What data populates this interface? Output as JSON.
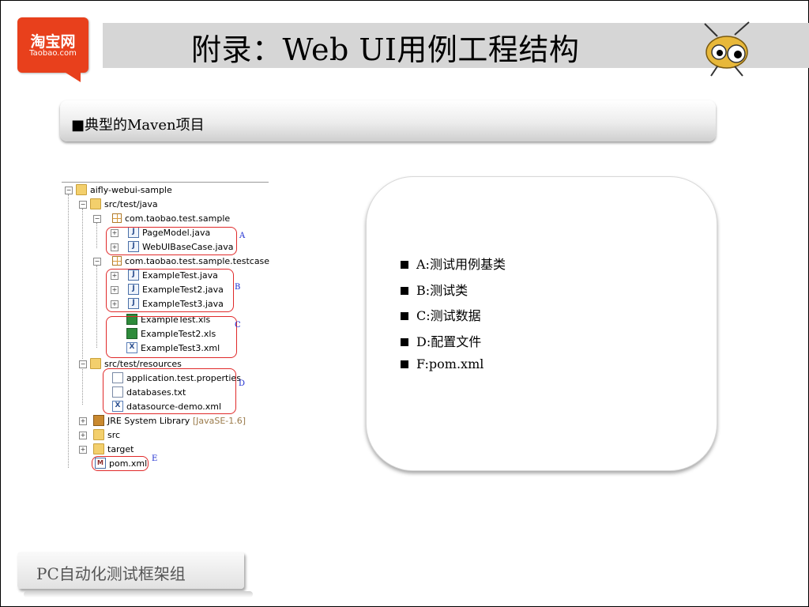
{
  "logo": {
    "cn": "淘宝网",
    "en": "Taobao.com"
  },
  "title": "附录：Web UI用例工程结构",
  "section_header": "■典型的Maven项目",
  "tree": {
    "root": "aifly-webui-sample",
    "src_test_java": "src/test/java",
    "pkg_sample": "com.taobao.test.sample",
    "page_model": "PageModel.java",
    "webui_base": "WebUIBaseCase.java",
    "pkg_testcase": "com.taobao.test.sample.testcase",
    "example_test": "ExampleTest.java",
    "example_test2": "ExampleTest2.java",
    "example_test3": "ExampleTest3.java",
    "example_xls": "ExampleTest.xls",
    "example2_xls": "ExampleTest2.xls",
    "example3_xml": "ExampleTest3.xml",
    "src_test_resources": "src/test/resources",
    "app_props": "application.test.properties",
    "databases_txt": "databases.txt",
    "datasource_xml": "datasource-demo.xml",
    "jre_lib": "JRE System Library",
    "jre_version": "[JavaSE-1.6]",
    "src": "src",
    "target": "target",
    "pom": "pom.xml",
    "mark_a": "A",
    "mark_b": "B",
    "mark_c": "C",
    "mark_d": "D",
    "mark_e": "E"
  },
  "legend": [
    "A:测试用例基类",
    "B:测试类",
    "C:测试数据",
    "D:配置文件",
    "F:pom.xml"
  ],
  "footer": "PC自动化测试框架组"
}
